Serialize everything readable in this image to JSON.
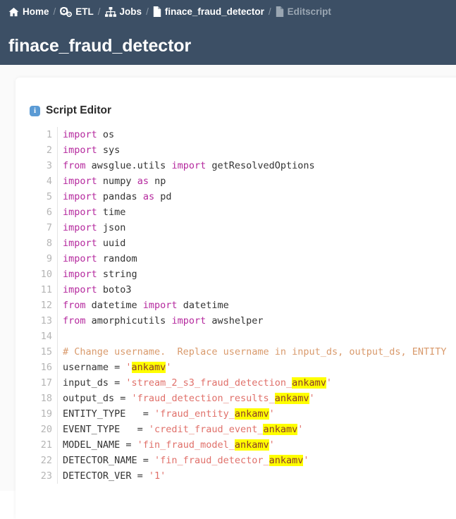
{
  "header": {
    "breadcrumb": [
      {
        "label": "Home",
        "icon": "home-icon",
        "muted": false
      },
      {
        "label": "ETL",
        "icon": "cogs-icon",
        "muted": false
      },
      {
        "label": "Jobs",
        "icon": "sitemap-icon",
        "muted": false
      },
      {
        "label": "finace_fraud_detector",
        "icon": "file-icon",
        "muted": false
      },
      {
        "label": "Editscript",
        "icon": "file-icon",
        "muted": true
      }
    ],
    "separator": "/",
    "page_title": "finace_fraud_detector"
  },
  "colors": {
    "header_bg": "#3c4f65",
    "page_bg": "#fafafa",
    "card_bg": "#ffffff",
    "info_icon": "#5b9bd5",
    "keyword": "#b5299e",
    "string": "#e0706a",
    "comment": "#d99a6c",
    "highlight": "#ffff00",
    "line_number": "#b5b5b5"
  },
  "editor_panel": {
    "info_icon_glyph": "i",
    "title": "Script Editor",
    "lines": [
      {
        "n": "1",
        "tokens": [
          {
            "t": "kw",
            "v": "import"
          },
          {
            "t": "p",
            "v": " os"
          }
        ]
      },
      {
        "n": "2",
        "tokens": [
          {
            "t": "kw",
            "v": "import"
          },
          {
            "t": "p",
            "v": " sys"
          }
        ]
      },
      {
        "n": "3",
        "tokens": [
          {
            "t": "kw",
            "v": "from"
          },
          {
            "t": "p",
            "v": " awsglue.utils "
          },
          {
            "t": "kw",
            "v": "import"
          },
          {
            "t": "p",
            "v": " getResolvedOptions"
          }
        ]
      },
      {
        "n": "4",
        "tokens": [
          {
            "t": "kw",
            "v": "import"
          },
          {
            "t": "p",
            "v": " numpy "
          },
          {
            "t": "kw",
            "v": "as"
          },
          {
            "t": "p",
            "v": " np"
          }
        ]
      },
      {
        "n": "5",
        "tokens": [
          {
            "t": "kw",
            "v": "import"
          },
          {
            "t": "p",
            "v": " pandas "
          },
          {
            "t": "kw",
            "v": "as"
          },
          {
            "t": "p",
            "v": " pd"
          }
        ]
      },
      {
        "n": "6",
        "tokens": [
          {
            "t": "kw",
            "v": "import"
          },
          {
            "t": "p",
            "v": " time"
          }
        ]
      },
      {
        "n": "7",
        "tokens": [
          {
            "t": "kw",
            "v": "import"
          },
          {
            "t": "p",
            "v": " json"
          }
        ]
      },
      {
        "n": "8",
        "tokens": [
          {
            "t": "kw",
            "v": "import"
          },
          {
            "t": "p",
            "v": " uuid"
          }
        ]
      },
      {
        "n": "9",
        "tokens": [
          {
            "t": "kw",
            "v": "import"
          },
          {
            "t": "p",
            "v": " random"
          }
        ]
      },
      {
        "n": "10",
        "tokens": [
          {
            "t": "kw",
            "v": "import"
          },
          {
            "t": "p",
            "v": " string"
          }
        ]
      },
      {
        "n": "11",
        "tokens": [
          {
            "t": "kw",
            "v": "import"
          },
          {
            "t": "p",
            "v": " boto3"
          }
        ]
      },
      {
        "n": "12",
        "tokens": [
          {
            "t": "kw",
            "v": "from"
          },
          {
            "t": "p",
            "v": " datetime "
          },
          {
            "t": "kw",
            "v": "import"
          },
          {
            "t": "p",
            "v": " datetime"
          }
        ]
      },
      {
        "n": "13",
        "tokens": [
          {
            "t": "kw",
            "v": "from"
          },
          {
            "t": "p",
            "v": " amorphicutils "
          },
          {
            "t": "kw",
            "v": "import"
          },
          {
            "t": "p",
            "v": " awshelper"
          }
        ]
      },
      {
        "n": "14",
        "tokens": []
      },
      {
        "n": "15",
        "tokens": [
          {
            "t": "com",
            "v": "# Change username.  Replace username in input_ds, output_ds, ENTITY"
          }
        ]
      },
      {
        "n": "16",
        "tokens": [
          {
            "t": "p",
            "v": "username = "
          },
          {
            "t": "str",
            "v": "'"
          },
          {
            "t": "hl",
            "v": "ankamv"
          },
          {
            "t": "str",
            "v": "'"
          }
        ]
      },
      {
        "n": "17",
        "tokens": [
          {
            "t": "p",
            "v": "input_ds = "
          },
          {
            "t": "str",
            "v": "'stream_2_s3_fraud_detection_"
          },
          {
            "t": "hl",
            "v": "ankamv"
          },
          {
            "t": "str",
            "v": "'"
          }
        ]
      },
      {
        "n": "18",
        "tokens": [
          {
            "t": "p",
            "v": "output_ds = "
          },
          {
            "t": "str",
            "v": "'fraud_detection_results_"
          },
          {
            "t": "hl",
            "v": "ankamv"
          },
          {
            "t": "str",
            "v": "'"
          }
        ]
      },
      {
        "n": "19",
        "tokens": [
          {
            "t": "p",
            "v": "ENTITY_TYPE   = "
          },
          {
            "t": "str",
            "v": "'fraud_entity_"
          },
          {
            "t": "hl",
            "v": "ankamv"
          },
          {
            "t": "str",
            "v": "'"
          }
        ]
      },
      {
        "n": "20",
        "tokens": [
          {
            "t": "p",
            "v": "EVENT_TYPE   = "
          },
          {
            "t": "str",
            "v": "'credit_fraud_event_"
          },
          {
            "t": "hl",
            "v": "ankamv"
          },
          {
            "t": "str",
            "v": "'"
          }
        ]
      },
      {
        "n": "21",
        "tokens": [
          {
            "t": "p",
            "v": "MODEL_NAME = "
          },
          {
            "t": "str",
            "v": "'fin_fraud_model_"
          },
          {
            "t": "hl",
            "v": "ankamv"
          },
          {
            "t": "str",
            "v": "'"
          }
        ]
      },
      {
        "n": "22",
        "tokens": [
          {
            "t": "p",
            "v": "DETECTOR_NAME = "
          },
          {
            "t": "str",
            "v": "'fin_fraud_detector_"
          },
          {
            "t": "hl",
            "v": "ankamv"
          },
          {
            "t": "str",
            "v": "'"
          }
        ]
      },
      {
        "n": "23",
        "tokens": [
          {
            "t": "p",
            "v": "DETECTOR_VER = "
          },
          {
            "t": "str",
            "v": "'1'"
          }
        ]
      }
    ]
  }
}
